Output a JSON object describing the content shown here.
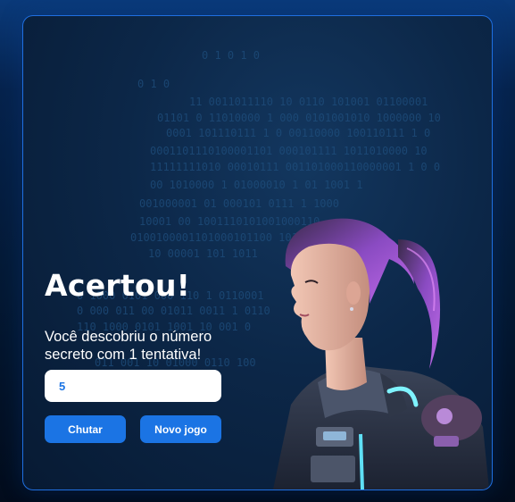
{
  "game": {
    "title": "Acertou!",
    "message": "Você descobriu o número secreto com 1 tentativa!",
    "input_value": "5",
    "guess_button": "Chutar",
    "new_game_button": "Novo jogo"
  },
  "background": {
    "binary_lines": [
      "0    1   0   1   0",
      "0          1          0",
      "11 0011011110 10 0110 101001 01100001",
      "01101 0 11010000 1   000 0101001010 1000000 10",
      "0001 101110111  1 0   00110000  100110111 1 0",
      "0001101110100001101 000101111  1011010000  10",
      "11111111010 00010111  001101000110000001 1 0  0",
      "00 1010000 1  01000010   1 01  1001  1",
      "001000001 01  000101 0111 1  1000",
      "10001 00 1001110101001000110",
      "0100100001101000101100 1011",
      "10 00001 101 1011",
      "0 1000 0101 000 110 1 0110001",
      "0 000  011 00 01011 0011 1 0110",
      "110 1000 0101 1001  10 001 0",
      "011 001 10 01000 0110 100"
    ],
    "colors": {
      "accent": "#1b74e4",
      "card_border": "#1f6fe0",
      "binary": "#1f4f7e"
    }
  },
  "illustration": {
    "icon": "hacker-woman-illustration"
  }
}
